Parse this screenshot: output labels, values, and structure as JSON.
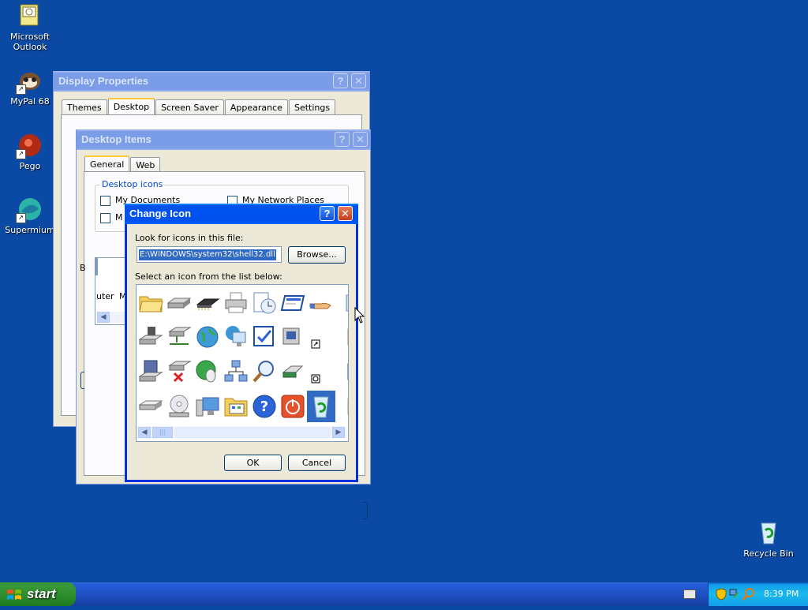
{
  "desktop": {
    "icons": [
      {
        "label": "Microsoft Outlook",
        "icon": "outlook-icon"
      },
      {
        "label": "MyPal 68",
        "icon": "mypal-icon"
      },
      {
        "label": "Pego",
        "icon": "pego-icon"
      },
      {
        "label": "Supermium",
        "icon": "supermium-icon"
      },
      {
        "label": "Recycle Bin",
        "icon": "recycle-bin-icon"
      }
    ]
  },
  "display_properties": {
    "title": "Display Properties",
    "tabs": [
      "Themes",
      "Desktop",
      "Screen Saver",
      "Appearance",
      "Settings"
    ],
    "selected_tab": "Desktop"
  },
  "desktop_items": {
    "title": "Desktop Items",
    "tabs": [
      "General",
      "Web"
    ],
    "selected_tab": "General",
    "group_label": "Desktop icons",
    "checkboxes": [
      "My Documents",
      "My Network Places",
      "M"
    ],
    "partial_texts": [
      "uter",
      "M",
      "B"
    ]
  },
  "change_icon": {
    "title": "Change Icon",
    "file_label": "Look for icons in this file:",
    "file_value": "E:\\WINDOWS\\system32\\shell32.dll",
    "browse_label": "Browse...",
    "list_label": "Select an icon from the list below:",
    "ok_label": "OK",
    "cancel_label": "Cancel",
    "selected_icon": "recycle-bin-full-icon"
  },
  "taskbar": {
    "start_label": "start",
    "clock": "8:39 PM"
  },
  "colors": {
    "desktop_bg": "#0a4aa5",
    "title_active": "#0053ee",
    "title_inactive": "#7b9ce6",
    "start_green": "#2f8f2f"
  }
}
